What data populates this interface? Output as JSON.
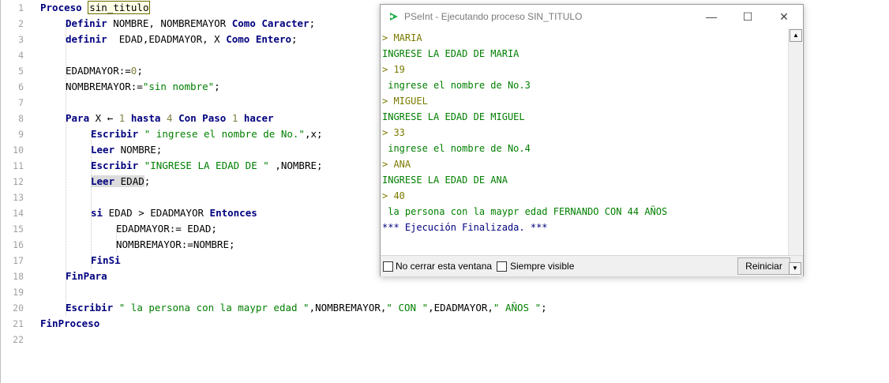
{
  "editor": {
    "line_numbers": [
      "1",
      "2",
      "3",
      "4",
      "5",
      "6",
      "7",
      "8",
      "9",
      "10",
      "11",
      "12",
      "13",
      "14",
      "15",
      "16",
      "17",
      "18",
      "19",
      "20",
      "21",
      "22"
    ],
    "l1": {
      "kw": "Proceso",
      "name": "sin_titulo"
    },
    "l2": {
      "kw1": "Definir",
      "vars": "NOMBRE, NOMBREMAYOR",
      "kw2": "Como Caracter",
      "semi": ";"
    },
    "l3": {
      "kw1": "definir",
      "vars": "  EDAD,EDADMAYOR, X",
      "kw2": "Como Entero",
      "semi": ";"
    },
    "l5": {
      "a": "EDADMAYOR:=",
      "n": "0",
      "b": ";"
    },
    "l6": {
      "a": "NOMBREMAYOR:=",
      "s": "\"sin nombre\"",
      "b": ";"
    },
    "l8": {
      "kw1": "Para",
      "v": "X",
      "arrow": "←",
      "n1": "1",
      "kw2": "hasta",
      "n2": "4",
      "kw3": "Con Paso",
      "n3": "1",
      "kw4": "hacer"
    },
    "l9": {
      "kw": "Escribir",
      "s": "\" ingrese el nombre de No.\"",
      "rest": ",x;"
    },
    "l10": {
      "kw": "Leer",
      "rest": "NOMBRE;"
    },
    "l11": {
      "kw": "Escribir",
      "s": "\"INGRESE LA EDAD DE \"",
      "rest": " ,NOMBRE;"
    },
    "l12": {
      "kw": "Leer",
      "v": "EDAD",
      "rest": ";"
    },
    "l14": {
      "kw1": "si",
      "cond": "EDAD > EDADMAYOR",
      "kw2": "Entonces"
    },
    "l15": {
      "text": "EDADMAYOR:= EDAD;"
    },
    "l16": {
      "text": "NOMBREMAYOR:=NOMBRE;"
    },
    "l17": {
      "kw": "FinSi"
    },
    "l18": {
      "kw": "FinPara"
    },
    "l20": {
      "kw": "Escribir",
      "s1": "\" la persona con la maypr edad \"",
      "c1": ",NOMBREMAYOR,",
      "s2": "\" CON \"",
      "c2": ",EDADMAYOR,",
      "s3": "\" AÑOS \"",
      "end": ";"
    },
    "l21": {
      "kw": "FinProceso"
    }
  },
  "console_window": {
    "title": "PSeInt - Ejecutando proceso SIN_TITULO",
    "minimize": "—",
    "maximize": "☐",
    "close": "✕",
    "lines": [
      {
        "text": "> MARIA",
        "kind": "input"
      },
      {
        "text": "INGRESE LA EDAD DE MARIA",
        "kind": "out"
      },
      {
        "text": "> 19",
        "kind": "input"
      },
      {
        "text": " ingrese el nombre de No.3",
        "kind": "out"
      },
      {
        "text": "> MIGUEL",
        "kind": "input"
      },
      {
        "text": "INGRESE LA EDAD DE MIGUEL",
        "kind": "out"
      },
      {
        "text": "> 33",
        "kind": "input"
      },
      {
        "text": " ingrese el nombre de No.4",
        "kind": "out"
      },
      {
        "text": "> ANA",
        "kind": "input"
      },
      {
        "text": "INGRESE LA EDAD DE ANA",
        "kind": "out"
      },
      {
        "text": "> 40",
        "kind": "input"
      },
      {
        "text": " la persona con la maypr edad FERNANDO CON 44 AÑOS",
        "kind": "out"
      },
      {
        "text": "*** Ejecución Finalizada. ***",
        "kind": "end"
      }
    ],
    "no_cerrar_label": "No cerrar esta ventana",
    "siempre_visible_label": "Siempre visible",
    "reiniciar_label": "Reiniciar",
    "colors": {
      "input": "#7a7a00",
      "out": "#007f00",
      "end": "#00007f",
      "app_icon": "#22b14c"
    }
  }
}
